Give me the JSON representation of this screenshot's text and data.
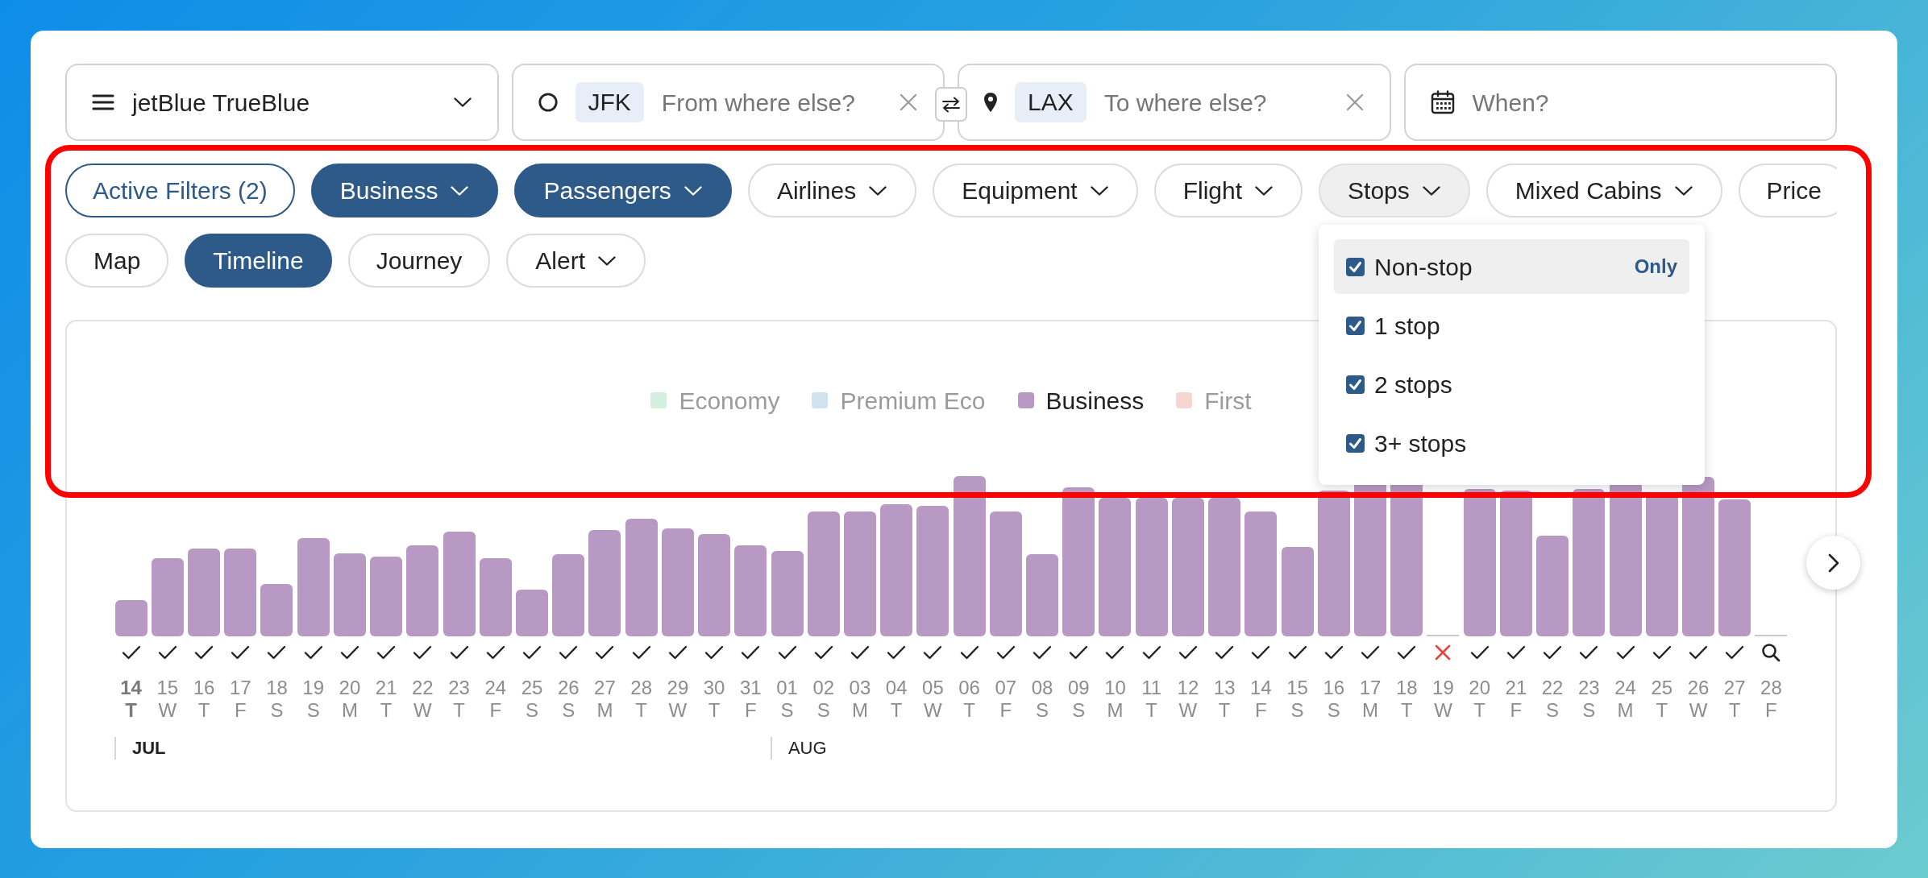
{
  "search_bar": {
    "program": {
      "label": "jetBlue TrueBlue"
    },
    "origin": {
      "code": "JFK",
      "placeholder": "From where else?"
    },
    "destination": {
      "code": "LAX",
      "placeholder": "To where else?"
    },
    "dates": {
      "placeholder": "When?"
    }
  },
  "filters": [
    {
      "label": "Active Filters (2)",
      "kind": "summary"
    },
    {
      "label": "Business",
      "kind": "dropdown",
      "active": true,
      "expanded": false
    },
    {
      "label": "Passengers",
      "kind": "dropdown",
      "active": true,
      "expanded": false
    },
    {
      "label": "Airlines",
      "kind": "dropdown",
      "active": false,
      "expanded": false
    },
    {
      "label": "Equipment",
      "kind": "dropdown",
      "active": false,
      "expanded": false
    },
    {
      "label": "Flight",
      "kind": "dropdown",
      "active": false,
      "expanded": false
    },
    {
      "label": "Stops",
      "kind": "dropdown",
      "active": false,
      "expanded": true,
      "menu": [
        {
          "label": "Non-stop",
          "checked": true,
          "highlighted": true,
          "action": "Only"
        },
        {
          "label": "1 stop",
          "checked": true,
          "highlighted": false
        },
        {
          "label": "2 stops",
          "checked": true,
          "highlighted": false
        },
        {
          "label": "3+ stops",
          "checked": true,
          "highlighted": false
        }
      ]
    },
    {
      "label": "Mixed Cabins",
      "kind": "dropdown",
      "active": false,
      "expanded": false
    },
    {
      "label": "Price",
      "kind": "plain",
      "active": false,
      "expanded": false
    }
  ],
  "views": [
    {
      "label": "Map",
      "kind": "toggle",
      "selected": false
    },
    {
      "label": "Timeline",
      "kind": "toggle",
      "selected": true
    },
    {
      "label": "Journey",
      "kind": "toggle",
      "selected": false
    },
    {
      "label": "Alert",
      "kind": "dropdown",
      "selected": false
    }
  ],
  "chart": {
    "legend": [
      {
        "label": "Economy",
        "color": "#d4eee0",
        "selected": false
      },
      {
        "label": "Premium Eco",
        "color": "#cfe2ee",
        "selected": false
      },
      {
        "label": "Business",
        "color": "#b799c4",
        "selected": true
      },
      {
        "label": "First",
        "color": "#f5d6d1",
        "selected": false
      }
    ],
    "months": [
      {
        "label": "JUL",
        "current": true,
        "days": [
          {
            "date": "14",
            "weekday": "T",
            "kind": "available",
            "current": true
          },
          {
            "date": "15",
            "weekday": "W",
            "kind": "available",
            "current": false
          },
          {
            "date": "16",
            "weekday": "T",
            "kind": "available",
            "current": false
          },
          {
            "date": "17",
            "weekday": "F",
            "kind": "available",
            "current": false
          },
          {
            "date": "18",
            "weekday": "S",
            "kind": "available",
            "current": false
          },
          {
            "date": "19",
            "weekday": "S",
            "kind": "available",
            "current": false
          },
          {
            "date": "20",
            "weekday": "M",
            "kind": "available",
            "current": false
          },
          {
            "date": "21",
            "weekday": "T",
            "kind": "available",
            "current": false
          },
          {
            "date": "22",
            "weekday": "W",
            "kind": "available",
            "current": false
          },
          {
            "date": "23",
            "weekday": "T",
            "kind": "available",
            "current": false
          },
          {
            "date": "24",
            "weekday": "F",
            "kind": "available",
            "current": false
          },
          {
            "date": "25",
            "weekday": "S",
            "kind": "available",
            "current": false
          },
          {
            "date": "26",
            "weekday": "S",
            "kind": "available",
            "current": false
          },
          {
            "date": "27",
            "weekday": "M",
            "kind": "available",
            "current": false
          },
          {
            "date": "28",
            "weekday": "T",
            "kind": "available",
            "current": false
          },
          {
            "date": "29",
            "weekday": "W",
            "kind": "available",
            "current": false
          },
          {
            "date": "30",
            "weekday": "T",
            "kind": "available",
            "current": false
          },
          {
            "date": "31",
            "weekday": "F",
            "kind": "available",
            "current": false
          }
        ]
      },
      {
        "label": "AUG",
        "current": false,
        "days": [
          {
            "date": "01",
            "weekday": "S",
            "kind": "available",
            "current": false
          },
          {
            "date": "02",
            "weekday": "S",
            "kind": "available",
            "current": false
          },
          {
            "date": "03",
            "weekday": "M",
            "kind": "available",
            "current": false
          },
          {
            "date": "04",
            "weekday": "T",
            "kind": "available",
            "current": false
          },
          {
            "date": "05",
            "weekday": "W",
            "kind": "available",
            "current": false
          },
          {
            "date": "06",
            "weekday": "T",
            "kind": "available",
            "current": false
          },
          {
            "date": "07",
            "weekday": "F",
            "kind": "available",
            "current": false
          },
          {
            "date": "08",
            "weekday": "S",
            "kind": "available",
            "current": false
          },
          {
            "date": "09",
            "weekday": "S",
            "kind": "available",
            "current": false
          },
          {
            "date": "10",
            "weekday": "M",
            "kind": "available",
            "current": false
          },
          {
            "date": "11",
            "weekday": "T",
            "kind": "available",
            "current": false
          },
          {
            "date": "12",
            "weekday": "W",
            "kind": "available",
            "current": false
          },
          {
            "date": "13",
            "weekday": "T",
            "kind": "available",
            "current": false
          },
          {
            "date": "14",
            "weekday": "F",
            "kind": "available",
            "current": false
          },
          {
            "date": "15",
            "weekday": "S",
            "kind": "available",
            "current": false
          },
          {
            "date": "16",
            "weekday": "S",
            "kind": "available",
            "current": false
          },
          {
            "date": "17",
            "weekday": "M",
            "kind": "available",
            "current": false
          },
          {
            "date": "18",
            "weekday": "T",
            "kind": "available",
            "current": false
          },
          {
            "date": "19",
            "weekday": "W",
            "kind": "unavailable",
            "current": false
          },
          {
            "date": "20",
            "weekday": "T",
            "kind": "available",
            "current": false
          },
          {
            "date": "21",
            "weekday": "F",
            "kind": "available",
            "current": false
          },
          {
            "date": "22",
            "weekday": "S",
            "kind": "available",
            "current": false
          },
          {
            "date": "23",
            "weekday": "S",
            "kind": "available",
            "current": false
          },
          {
            "date": "24",
            "weekday": "M",
            "kind": "available",
            "current": false
          },
          {
            "date": "25",
            "weekday": "T",
            "kind": "available",
            "current": false
          },
          {
            "date": "26",
            "weekday": "W",
            "kind": "available",
            "current": false
          },
          {
            "date": "27",
            "weekday": "T",
            "kind": "available",
            "current": false
          },
          {
            "date": "28",
            "weekday": "F",
            "kind": "unsearched",
            "current": false
          }
        ]
      }
    ]
  }
}
